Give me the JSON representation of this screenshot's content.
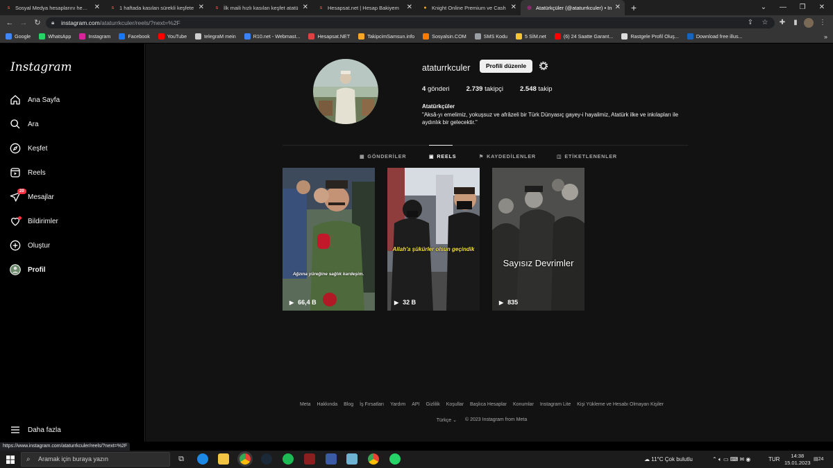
{
  "browser": {
    "tabs": [
      {
        "title": "Sosyal Medya hesaplarını hemen",
        "active": false
      },
      {
        "title": "1 haftada kasılan sürekli keşfete",
        "active": false
      },
      {
        "title": "İlk maili hızlı kasılan keşfet atatü",
        "active": false
      },
      {
        "title": "Hesapsat.net | Hesap Bakiyem",
        "active": false
      },
      {
        "title": "Knight Online Premium ve Cash",
        "active": false
      },
      {
        "title": "Atatürkçüler (@ataturrkculer) • In",
        "active": true
      }
    ],
    "new_tab": "+",
    "url_host": "instagram.com",
    "url_path": "/ataturrkculer/reels/?next=%2F",
    "bookmarks": [
      {
        "label": "Google",
        "color": "#4285f4"
      },
      {
        "label": "WhatsApp",
        "color": "#25d366"
      },
      {
        "label": "Instagram",
        "color": "#d6249f"
      },
      {
        "label": "Facebook",
        "color": "#1877f2"
      },
      {
        "label": "YouTube",
        "color": "#ff0000"
      },
      {
        "label": "telegraM mein",
        "color": "#cfcfcf"
      },
      {
        "label": "R10.net - Webmast...",
        "color": "#3b82f6"
      },
      {
        "label": "Hesapsat.NET",
        "color": "#e04040"
      },
      {
        "label": "TakipcimSamsun.info",
        "color": "#f5a623"
      },
      {
        "label": "Sosyalsin.COM",
        "color": "#f57c00"
      },
      {
        "label": "SMS Kodu",
        "color": "#9aa0a6"
      },
      {
        "label": "5 SİM.net",
        "color": "#f7c531"
      },
      {
        "label": "(6) 24 Saatte Garant...",
        "color": "#ff0000"
      },
      {
        "label": "Rastgele Profil Oluş...",
        "color": "#dddddd"
      },
      {
        "label": "Download free illus...",
        "color": "#1565c0"
      }
    ],
    "bookmarks_more": "»",
    "status_url": "https://www.instagram.com/ataturrkculer/reels/?next=%2F"
  },
  "sidebar": {
    "logo": "Instagram",
    "items": [
      {
        "label": "Ana Sayfa",
        "icon": "home-icon"
      },
      {
        "label": "Ara",
        "icon": "search-icon"
      },
      {
        "label": "Keşfet",
        "icon": "compass-icon"
      },
      {
        "label": "Reels",
        "icon": "reels-icon"
      },
      {
        "label": "Mesajlar",
        "icon": "messenger-icon",
        "badge": "20"
      },
      {
        "label": "Bildirimler",
        "icon": "heart-icon"
      },
      {
        "label": "Oluştur",
        "icon": "plus-square-icon"
      },
      {
        "label": "Profil",
        "icon": "avatar-icon"
      }
    ],
    "more": "Daha fazla"
  },
  "profile": {
    "username": "ataturrkculer",
    "edit_button": "Profili düzenle",
    "posts_count": "4",
    "posts_label": "gönderi",
    "followers_count": "2.739",
    "followers_label": "takipçi",
    "following_count": "2.548",
    "following_label": "takip",
    "full_name": "Atatürkçüler",
    "bio": "\"Aksâ-yı emelimiz, yokuşsuz ve afrâzeli bir Türk Dünyasıç gayey-i hayalimiz, Atatürk ilke ve inkılapları ile aydınlık bir gelecektir.\""
  },
  "profile_tabs": [
    {
      "label": "GÖNDERİLER",
      "icon": "grid-icon",
      "active": false
    },
    {
      "label": "REELS",
      "icon": "reels-icon",
      "active": true
    },
    {
      "label": "KAYDEDİLENLER",
      "icon": "bookmark-icon",
      "active": false
    },
    {
      "label": "ETİKETLENENLER",
      "icon": "tag-icon",
      "active": false
    }
  ],
  "reels": [
    {
      "views": "66,4 B",
      "caption": "Ağzına yüreğine sağlık kardeşim."
    },
    {
      "views": "32 B",
      "caption": "Allah'a şükürler olsun geçindik"
    },
    {
      "views": "835",
      "caption": "Sayısız Devrimler"
    }
  ],
  "footer": {
    "links": [
      "Meta",
      "Hakkında",
      "Blog",
      "İş Fırsatları",
      "Yardım",
      "API",
      "Gizlilik",
      "Koşullar",
      "Başlıca Hesaplar",
      "Konumlar",
      "Instagram Lite",
      "Kişi Yükleme ve Hesabı Olmayan Kişiler"
    ],
    "language": "Türkçe",
    "copyright": "© 2023 Instagram from Meta"
  },
  "taskbar": {
    "search_placeholder": "Aramak için buraya yazın",
    "weather": "11°C  Çok bulutlu",
    "lang": "TUR",
    "time": "14:38",
    "date": "15.01.2023",
    "notif_count": "24"
  }
}
